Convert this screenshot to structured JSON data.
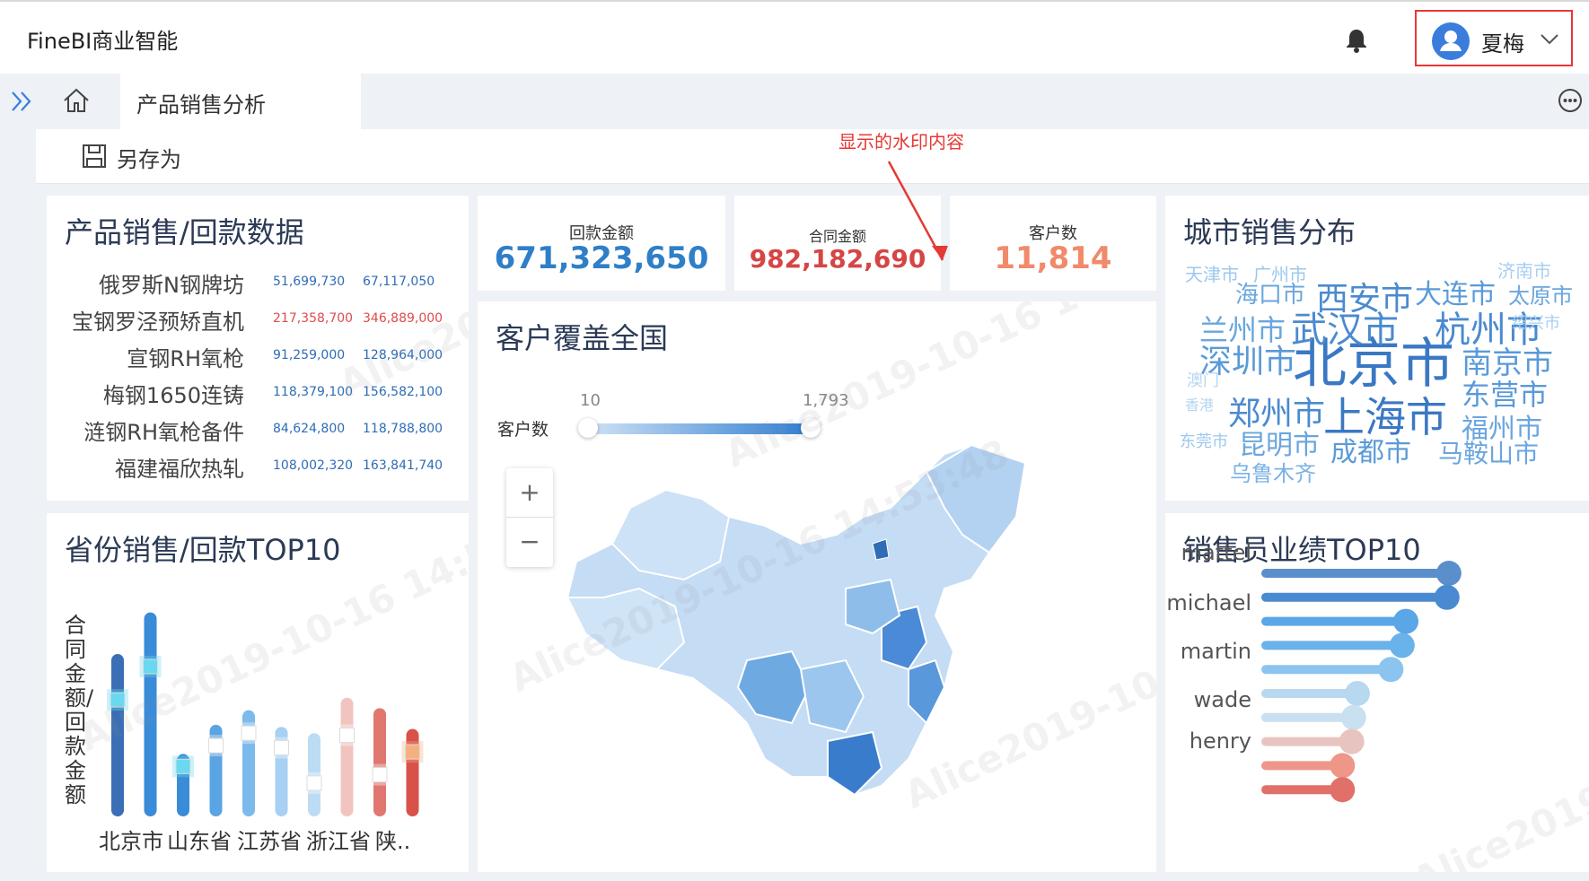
{
  "app": {
    "title": "FineBI商业智能"
  },
  "user": {
    "name": "夏梅"
  },
  "tab": {
    "label": "产品销售分析"
  },
  "toolbar": {
    "save_as": "另存为"
  },
  "annotation": {
    "text": "显示的水印内容"
  },
  "watermark": {
    "text": "Alice2019-10-16 14:53:48"
  },
  "colors": {
    "accent": "#3b7ddd",
    "red": "#e04b4b",
    "annotation": "#e53935"
  },
  "product_table": {
    "title": "产品销售/回款数据",
    "rows": [
      {
        "name": "俄罗斯N钢牌坊",
        "v1": "51,699,730",
        "v2": "67,117,050",
        "color": "#2f6db5"
      },
      {
        "name": "宝钢罗泾预矫直机",
        "v1": "217,358,700",
        "v2": "346,889,000",
        "color": "#e04b4b"
      },
      {
        "name": "宣钢RH氧枪",
        "v1": "91,259,000",
        "v2": "128,964,000",
        "color": "#2f6db5"
      },
      {
        "name": "梅钢1650连铸",
        "v1": "118,379,100",
        "v2": "156,582,100",
        "color": "#2f6db5"
      },
      {
        "name": "涟钢RH氧枪备件",
        "v1": "84,624,800",
        "v2": "118,788,800",
        "color": "#2f6db5"
      },
      {
        "name": "福建福欣热轧",
        "v1": "108,002,320",
        "v2": "163,841,740",
        "color": "#2f6db5"
      }
    ]
  },
  "kpis": [
    {
      "label": "回款金额",
      "value": "671,323,650",
      "color": "#2f7fc8"
    },
    {
      "label": "合同金额",
      "value": "982,182,690",
      "color": "#d64545"
    },
    {
      "label": "客户数",
      "value": "11,814",
      "color": "#f08a6a"
    }
  ],
  "map": {
    "title": "客户覆盖全国",
    "legend_label": "客户数",
    "range_min": "10",
    "range_max": "1,793",
    "zoom_in": "+",
    "zoom_out": "−"
  },
  "wordcloud": {
    "title": "城市销售分布",
    "words": [
      {
        "text": "北京市",
        "size": 60,
        "color": "#3a78c4"
      },
      {
        "text": "上海市",
        "size": 46,
        "color": "#3a78c4"
      },
      {
        "text": "武汉市",
        "size": 40,
        "color": "#4a8ad0"
      },
      {
        "text": "杭州市",
        "size": 40,
        "color": "#4a8ad0"
      },
      {
        "text": "西安市",
        "size": 36,
        "color": "#4a8ad0"
      },
      {
        "text": "大连市",
        "size": 30,
        "color": "#5a9ad8"
      },
      {
        "text": "深圳市",
        "size": 36,
        "color": "#5a9ad8"
      },
      {
        "text": "南京市",
        "size": 34,
        "color": "#5a9ad8"
      },
      {
        "text": "郑州市",
        "size": 36,
        "color": "#4a8ad0"
      },
      {
        "text": "东营市",
        "size": 32,
        "color": "#5a9ad8"
      },
      {
        "text": "兰州市",
        "size": 32,
        "color": "#6aa6de"
      },
      {
        "text": "海口市",
        "size": 26,
        "color": "#6aa6de"
      },
      {
        "text": "太原市",
        "size": 24,
        "color": "#6aa6de"
      },
      {
        "text": "福州市",
        "size": 30,
        "color": "#6aa6de"
      },
      {
        "text": "昆明市",
        "size": 30,
        "color": "#6aa6de"
      },
      {
        "text": "成都市",
        "size": 30,
        "color": "#5a9ad8"
      },
      {
        "text": "马鞍山市",
        "size": 28,
        "color": "#6aa6de"
      },
      {
        "text": "乌鲁木齐",
        "size": 24,
        "color": "#7ab2e4"
      },
      {
        "text": "天津市",
        "size": 20,
        "color": "#9cc8ee"
      },
      {
        "text": "广州市",
        "size": 20,
        "color": "#9cc8ee"
      },
      {
        "text": "济南市",
        "size": 20,
        "color": "#a8cff0"
      },
      {
        "text": "绍兴市",
        "size": 18,
        "color": "#a8cff0"
      },
      {
        "text": "澳门",
        "size": 18,
        "color": "#b4d6f2"
      },
      {
        "text": "香港",
        "size": 16,
        "color": "#b4d6f2"
      },
      {
        "text": "东莞市",
        "size": 18,
        "color": "#9cc8ee"
      }
    ]
  },
  "province_chart": {
    "title": "省份销售/回款TOP10",
    "ylabel": "合同金额/回款金额",
    "xticks": [
      "北京市",
      "山东省",
      "江苏省",
      "浙江省",
      "陕.."
    ]
  },
  "sales_rank": {
    "title": "销售员业绩TOP10",
    "names": [
      "mattel",
      "michael",
      "martin",
      "wade",
      "henry"
    ]
  },
  "chart_data": [
    {
      "type": "bar",
      "title": "省份销售/回款TOP10",
      "ylabel": "合同金额/回款金额",
      "categories": [
        "北京市",
        "山东省",
        "江苏省",
        "浙江省",
        "陕.."
      ],
      "bars": [
        0.78,
        0.98,
        0.3,
        0.44,
        0.51,
        0.43,
        0.4,
        0.57,
        0.52,
        0.42
      ],
      "markers": [
        0.56,
        0.72,
        0.24,
        0.34,
        0.4,
        0.33,
        0.16,
        0.39,
        0.2,
        0.31
      ],
      "bar_colors": [
        "#3a6fb5",
        "#3a8bd8",
        "#3a8bd8",
        "#5ba4e4",
        "#7dbaec",
        "#a7d0f2",
        "#bcdcf4",
        "#f2c4c0",
        "#e07870",
        "#d8524a"
      ],
      "marker_colors": [
        "#6ad9f0",
        "#6ad9f0",
        "#6ad9f0",
        "#ffffff",
        "#ffffff",
        "#ffffff",
        "#ffffff",
        "#ffffff",
        "#ffffff",
        "#f6b080"
      ]
    },
    {
      "type": "bar",
      "title": "销售员业绩TOP10",
      "orientation": "horizontal",
      "names": [
        "mattel",
        "michael",
        "martin",
        "wade",
        "henry"
      ],
      "values": [
        0.98,
        0.97,
        0.75,
        0.73,
        0.67,
        0.49,
        0.47,
        0.46,
        0.41,
        0.41
      ],
      "colors": [
        "#5a8fcc",
        "#4a8ad0",
        "#5aa6e6",
        "#6ab2ea",
        "#8cc4f0",
        "#b8d8ef",
        "#c8e0f0",
        "#e8c4c0",
        "#ee9688",
        "#e07068"
      ]
    }
  ]
}
